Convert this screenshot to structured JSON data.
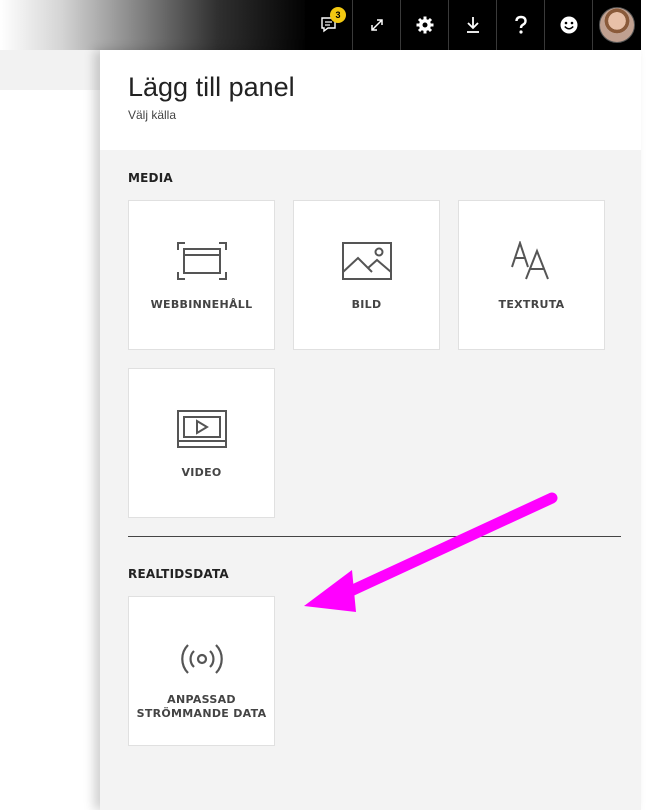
{
  "topbar": {
    "notification_count": "3",
    "buttons": [
      "notifications-icon",
      "fullscreen-icon",
      "gear-icon",
      "download-icon",
      "help-icon",
      "smiley-icon",
      "avatar"
    ]
  },
  "panel": {
    "title": "Lägg till panel",
    "subtitle": "Välj källa"
  },
  "media": {
    "heading": "MEDIA",
    "tiles": [
      {
        "label": "WEBBINNEHÅLL",
        "icon": "web-content-icon"
      },
      {
        "label": "BILD",
        "icon": "image-icon"
      },
      {
        "label": "TEXTRUTA",
        "icon": "textbox-icon"
      },
      {
        "label": "VIDEO",
        "icon": "video-icon"
      }
    ]
  },
  "realtime": {
    "heading": "REALTIDSDATA",
    "tiles": [
      {
        "label_line1": "ANPASSAD",
        "label_line2": "STRÖMMANDE DATA",
        "icon": "streaming-icon"
      }
    ]
  },
  "colors": {
    "arrow": "#ff00ff",
    "badge": "#f2c811",
    "topbar": "#000000"
  }
}
